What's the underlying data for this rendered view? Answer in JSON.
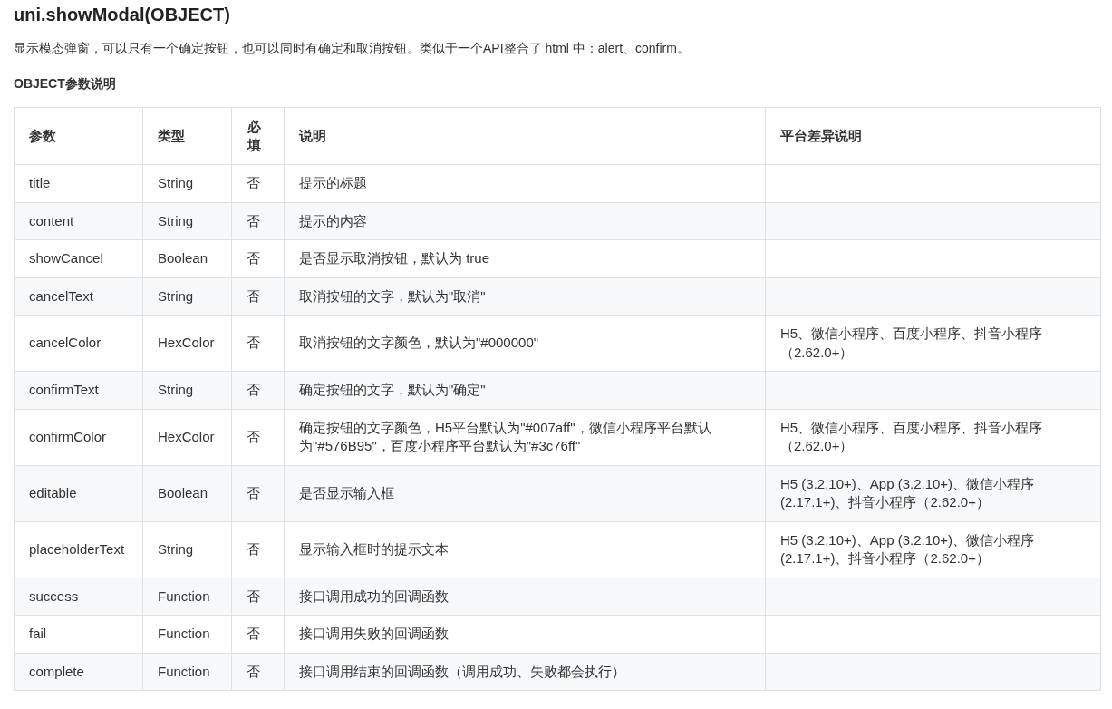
{
  "title": "uni.showModal(OBJECT)",
  "description": "显示模态弹窗，可以只有一个确定按钮，也可以同时有确定和取消按钮。类似于一个API整合了 html 中：alert、confirm。",
  "subtitle": "OBJECT参数说明",
  "table": {
    "columns": [
      "参数",
      "类型",
      "必填",
      "说明",
      "平台差异说明"
    ],
    "rows": [
      [
        "title",
        "String",
        "否",
        "提示的标题",
        ""
      ],
      [
        "content",
        "String",
        "否",
        "提示的内容",
        ""
      ],
      [
        "showCancel",
        "Boolean",
        "否",
        "是否显示取消按钮，默认为 true",
        ""
      ],
      [
        "cancelText",
        "String",
        "否",
        "取消按钮的文字，默认为\"取消\"",
        ""
      ],
      [
        "cancelColor",
        "HexColor",
        "否",
        "取消按钮的文字颜色，默认为\"#000000\"",
        "H5、微信小程序、百度小程序、抖音小程序（2.62.0+）"
      ],
      [
        "confirmText",
        "String",
        "否",
        "确定按钮的文字，默认为\"确定\"",
        ""
      ],
      [
        "confirmColor",
        "HexColor",
        "否",
        "确定按钮的文字颜色，H5平台默认为\"#007aff\"，微信小程序平台默认为\"#576B95\"，百度小程序平台默认为\"#3c76ff\"",
        "H5、微信小程序、百度小程序、抖音小程序（2.62.0+）"
      ],
      [
        "editable",
        "Boolean",
        "否",
        "是否显示输入框",
        "H5 (3.2.10+)、App (3.2.10+)、微信小程序 (2.17.1+)、抖音小程序（2.62.0+）"
      ],
      [
        "placeholderText",
        "String",
        "否",
        "显示输入框时的提示文本",
        "H5 (3.2.10+)、App (3.2.10+)、微信小程序 (2.17.1+)、抖音小程序（2.62.0+）"
      ],
      [
        "success",
        "Function",
        "否",
        "接口调用成功的回调函数",
        ""
      ],
      [
        "fail",
        "Function",
        "否",
        "接口调用失败的回调函数",
        ""
      ],
      [
        "complete",
        "Function",
        "否",
        "接口调用结束的回调函数（调用成功、失败都会执行）",
        ""
      ]
    ]
  }
}
